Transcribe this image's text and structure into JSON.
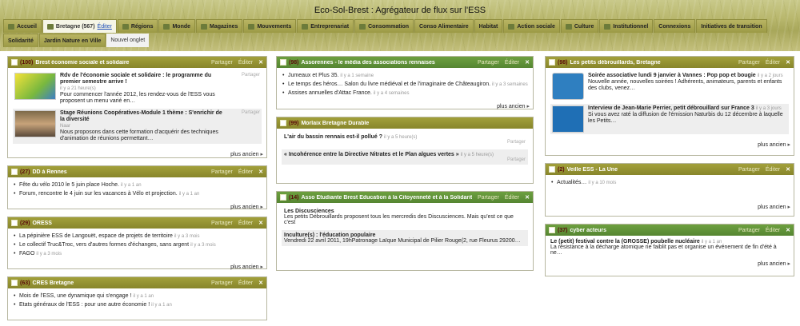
{
  "site_title": "Eco-Sol-Brest : Agrégateur de flux sur l'ESS",
  "tabs": [
    {
      "label": "Accueil",
      "icon": "home-icon"
    },
    {
      "label": "Bretagne (567)",
      "edit": "Éditer",
      "active": true,
      "icon": "house-icon"
    },
    {
      "label": "Régions",
      "icon": "map-icon"
    },
    {
      "label": "Monde",
      "icon": "globe-icon"
    },
    {
      "label": "Magazines",
      "icon": "magazine-icon"
    },
    {
      "label": "Mouvements",
      "icon": "people-icon"
    },
    {
      "label": "Entreprenariat",
      "icon": "briefcase-icon"
    },
    {
      "label": "Consommation",
      "icon": "cart-icon"
    },
    {
      "label": "Conso Alimentaire",
      "icon": ""
    },
    {
      "label": "Habitat",
      "icon": ""
    },
    {
      "label": "Action sociale",
      "icon": "smile-icon"
    },
    {
      "label": "Culture",
      "icon": "culture-icon"
    },
    {
      "label": "Institutionnel",
      "icon": "building-icon"
    },
    {
      "label": "Connexions",
      "icon": ""
    },
    {
      "label": "Initiatives de transition",
      "icon": ""
    },
    {
      "label": "Solidarité",
      "icon": ""
    },
    {
      "label": "Jardin Nature en Ville",
      "icon": ""
    },
    {
      "label": "Nouvel onglet",
      "plain": true
    }
  ],
  "common": {
    "share": "Partager",
    "edit": "Éditer",
    "close": "✕",
    "more": "plus ancien"
  },
  "w1": {
    "count": "(100)",
    "title": "Brest économie sociale et solidaire",
    "a1_title": "Rdv de l'économie sociale et solidaire : le programme du premier semestre arrive !",
    "a1_age": "il y a 21 heure(s)",
    "a1_text": "Pour commencer l'année 2012, les rendez-vous de l'ESS vous proposent un menu varié en…",
    "a2_title": "Stage Réunions Coopératives-Module 1 thème : S'enrichir de la diversité",
    "a2_age": "Naar",
    "a2_text": "Nous proposons dans cette formation d'acquérir des techniques d'animation de réunions permettant…"
  },
  "w2": {
    "count": "(27)",
    "title": "DD à Rennes",
    "i1": "Fête du vélo 2010 le 5 juin place Hoche.",
    "i1_age": "il y a 1 an",
    "i2": "Forum, rencontre le 4 juin sur les vacances à Vélo et projection.",
    "i2_age": "il y a 1 an"
  },
  "w3": {
    "count": "(29)",
    "title": "ORESS",
    "i1": "La pépinière ESS de Langouët, espace de projets de territoire",
    "i1_age": "il y a 3 mois",
    "i2": "Le collectif Truc&Troc, vers d'autres formes d'échanges, sans argent",
    "i2_age": "il y a 3 mois",
    "i3": "FAGO",
    "i3_age": "il y a 3 mois"
  },
  "w4": {
    "count": "(63)",
    "title": "CRES Bretagne",
    "i1": "Mois de l'ESS, une dynamique qui s'engage !",
    "i1_age": "il y a 1 an",
    "i2": "Etats généraux de l'ESS : pour une autre économie !",
    "i2_age": "il y a 1 an"
  },
  "w5": {
    "count": "(98)",
    "title": "Assorennes - le média des associations rennaises",
    "i1": "Jumeaux et Plus 35.",
    "i1_age": "il y a 1 semaine",
    "i2": "Le temps des héros… Salon du livre médiéval et de l'imaginaire de Châteaugiron.",
    "i2_age": "il y a 3 semaines",
    "i3": "Assises annuelles d'Attac France.",
    "i3_age": "il y a 4 semaines"
  },
  "w6": {
    "count": "(99)",
    "title": "Morlaix Bretagne Durable",
    "b1": "L'air du bassin rennais est-il pollué ?",
    "b1_age": "il y a 5 heure(s)",
    "b2": "« Incohérence entre la Directive Nitrates et le Plan algues vertes »",
    "b2_age": "il y a 5 heure(s)"
  },
  "w7": {
    "count": "(14)",
    "title": "Asso Etudiante Brest Education à la Citoyenneté et à la Solidarité",
    "b1_title": "Les Discusciences",
    "b1_text": "Les petits Débrouillards proposent tous les mercredis des Discusciences. Mais qu'est ce que c'est",
    "b2_title": "Inculture(s) : l'éducation populaire",
    "b2_text": "Vendredi 22 avril 2011, 19hPatronage Laïque Municipal de Pilier Rouge(2, rue Fleurus 29200…"
  },
  "w8": {
    "count": "(98)",
    "title": "Les petits débrouillards, Bretagne",
    "a1_title": "Soirée associative lundi 9 janvier à Vannes : Pop pop et bougie",
    "a1_age": "il y a 2 jours",
    "a1_text": "Nouvelle année, nouvelles soirées ! Adhérents, animateurs, parents et enfants des clubs, venez…",
    "a2_title": "Interview de Jean-Marie Perrier, petit débrouillard sur France 3",
    "a2_age": "il y a 3 jours",
    "a2_text": "Si vous avez raté la diffusion de l'émission Naturbis du 12 décembre à laquelle les Petits…"
  },
  "w9": {
    "count": "(2)",
    "title": "Veille ESS - La Une",
    "i1": "Actualités…",
    "i1_age": "il y a 10 mois"
  },
  "w10": {
    "count": "(37)",
    "title": "cyber acteurs",
    "b1_title": "Le (petit) festival contre la (GROSSE) poubelle nucléaire",
    "b1_age": "il y a 1 an",
    "b1_text": "La résistance à la décharge atomique ne faiblit pas et organise un événement de fin d'été à ne…"
  },
  "colors": {
    "olive": "#969436",
    "green": "#62953a",
    "bg": "#ffffff"
  }
}
